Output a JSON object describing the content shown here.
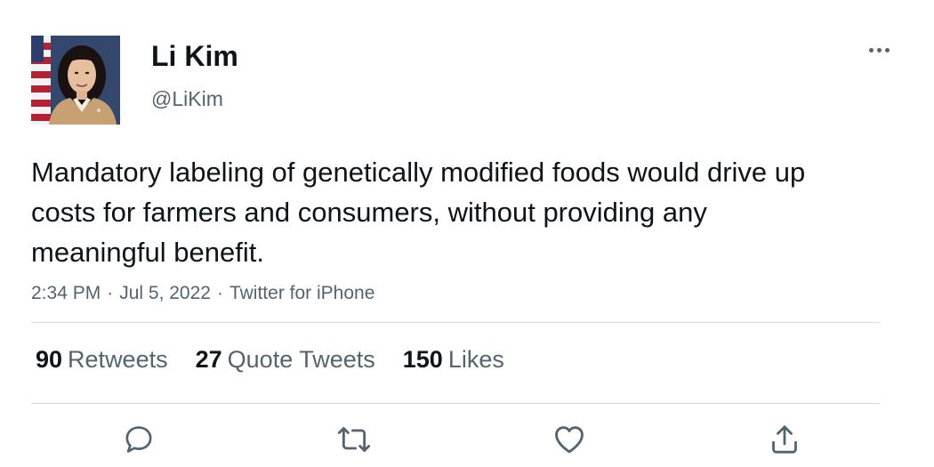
{
  "tweet": {
    "author": {
      "display_name": "Li Kim",
      "handle": "@LiKim",
      "avatar_icon": "profile-photo"
    },
    "text": "Mandatory labeling of genetically modified foods would drive up costs for farmers and consumers, without providing any meaningful benefit.",
    "time": "2:34 PM",
    "separator": "·",
    "date": "Jul 5, 2022",
    "source": "Twitter for iPhone",
    "stats": {
      "retweets": {
        "count": "90",
        "label": "Retweets"
      },
      "quote_tweets": {
        "count": "27",
        "label": "Quote Tweets"
      },
      "likes": {
        "count": "150",
        "label": "Likes"
      }
    },
    "actions": [
      "reply-icon",
      "retweet-icon",
      "like-icon",
      "share-icon"
    ],
    "more_icon": "more-icon"
  },
  "colors": {
    "text_primary": "#0f1419",
    "text_secondary": "#536471",
    "divider": "#cfd9de",
    "background": "#ffffff"
  }
}
